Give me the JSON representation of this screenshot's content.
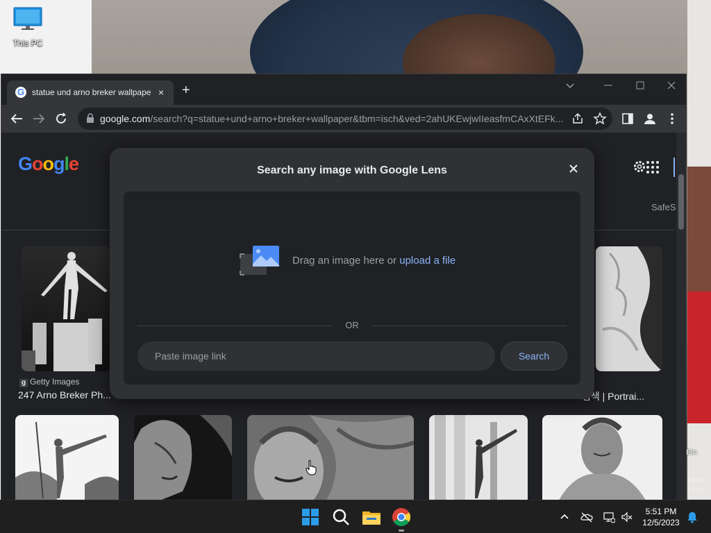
{
  "desktop": {
    "icon_label": "This PC",
    "bin_label": "Bin",
    "review_label": "eview",
    "review_sub": "1416"
  },
  "browser": {
    "tab_title": "statue und arno breker wallpape",
    "tab_close": "×",
    "new_tab": "+",
    "url_host": "google.com",
    "url_rest": "/search?q=statue+und+arno+breker+wallpaper&tbm=isch&ved=2ahUKEwjwIIeasfmCAxXtEFk..."
  },
  "page": {
    "logo_letters": [
      "G",
      "o",
      "o",
      "g",
      "l",
      "e"
    ],
    "logo_colors": [
      "#4285f4",
      "#ea4335",
      "#fbbc05",
      "#4285f4",
      "#34a853",
      "#ea4335"
    ],
    "safesearch_label": "SafeS",
    "results": [
      {
        "source": "Getty Images",
        "title": "247 Arno Breker Ph..."
      },
      {
        "source": "",
        "title": "검색 | Portrai..."
      }
    ]
  },
  "lens_modal": {
    "title": "Search any image with Google Lens",
    "drag_text": "Drag an image here or ",
    "upload_link": "upload a file",
    "or_label": "OR",
    "paste_placeholder": "Paste image link",
    "search_button": "Search"
  },
  "taskbar": {
    "time": "5:51 PM",
    "date": "12/5/2023"
  }
}
